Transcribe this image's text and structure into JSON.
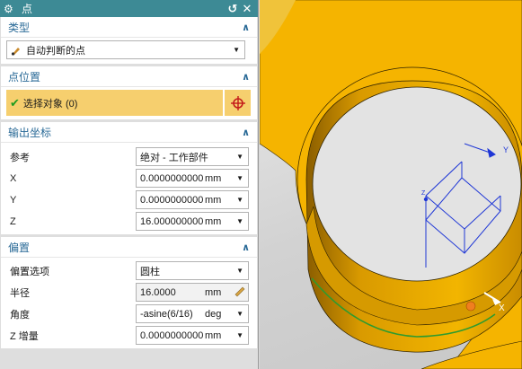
{
  "dialog": {
    "title": "点",
    "reset_icon": "reset-icon",
    "close_icon": "close-icon"
  },
  "type_section": {
    "title": "类型",
    "selected": "自动判断的点"
  },
  "point_location": {
    "title": "点位置",
    "select_label": "选择对象 (0)"
  },
  "output_coords": {
    "title": "输出坐标",
    "rows": [
      {
        "label": "参考",
        "value": "绝对 - 工作部件"
      },
      {
        "label": "X",
        "value": "0.0000000000",
        "unit": "mm"
      },
      {
        "label": "Y",
        "value": "0.0000000000",
        "unit": "mm"
      },
      {
        "label": "Z",
        "value": "16.0000000000",
        "unit": "mm"
      }
    ]
  },
  "offset": {
    "title": "偏置",
    "rows": [
      {
        "label": "偏置选项",
        "value": "圆柱"
      },
      {
        "label": "半径",
        "value": "16.0000",
        "unit": "mm"
      },
      {
        "label": "角度",
        "value": "-asine(6/16)",
        "unit": "deg"
      },
      {
        "label": "Z 增量",
        "value": "0.0000000000",
        "unit": "mm"
      }
    ]
  },
  "viewport": {
    "axis_x": "X",
    "axis_y": "Y",
    "axis_z": "Z",
    "part_color": "#f5b400",
    "accent": "#3d8a95"
  }
}
